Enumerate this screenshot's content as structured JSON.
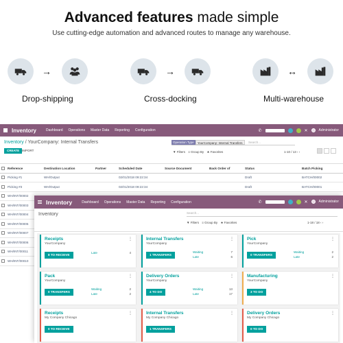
{
  "hero": {
    "title_bold": "Advanced features",
    "title_rest": " made simple",
    "subtitle": "Use cutting-edge automation and advanced routes to manage any warehouse."
  },
  "features": [
    {
      "label": "Drop-shipping",
      "left_icon": "truck-icon",
      "right_icon": "people-icon",
      "arrow": "→"
    },
    {
      "label": "Cross-docking",
      "left_icon": "truck-icon",
      "right_icon": "truck-icon",
      "arrow": "→"
    },
    {
      "label": "Multi-warehouse",
      "left_icon": "factory-icon",
      "right_icon": "factory-icon",
      "arrow": "↔"
    }
  ],
  "colors": {
    "brand": "#875a7b",
    "accent": "#00a09d",
    "icon_circle": "#dde4ea",
    "warning": "#f0ad4e",
    "danger": "#e45c4a"
  },
  "win1": {
    "app_name": "Inventory",
    "menus": [
      "Dashboard",
      "Operations",
      "Master Data",
      "Reporting",
      "Configuration"
    ],
    "user": "Administrator",
    "breadcrumb_root": "Inventory",
    "breadcrumb_sep": " / ",
    "breadcrumb_current": "YourCompany: Internal Transfers",
    "create": "CREATE",
    "import": "IMPORT",
    "facet_key": "Operation Type",
    "facet_value": "YourCompany: Internal Transfers",
    "search_placeholder": "Search...",
    "filters": "Filters",
    "group_by": "Group By",
    "favorites": "Favorites",
    "pager": "1-10 / 13",
    "columns": [
      "Reference",
      "Destination Location",
      "Partner",
      "Scheduled Date",
      "Source Document",
      "Back Order of",
      "Status",
      "Batch Picking"
    ],
    "rows": [
      [
        "Picking #1",
        "WH/Output",
        "",
        "02/01/2018 09:22:34",
        "",
        "",
        "Draft",
        "BATCH/00002"
      ],
      [
        "Picking #3",
        "WH/Output",
        "",
        "02/01/2018 09:22:34",
        "",
        "",
        "Draft",
        "BATCH/00001"
      ],
      [
        "WH/INT/00002",
        "",
        "",
        "",
        "",
        "",
        "",
        ""
      ],
      [
        "WH/INT/00003",
        "",
        "",
        "",
        "",
        "",
        "",
        ""
      ],
      [
        "WH/INT/00004",
        "",
        "",
        "",
        "",
        "",
        "",
        ""
      ],
      [
        "WH/INT/00005",
        "",
        "",
        "",
        "",
        "",
        "",
        ""
      ],
      [
        "WH/INT/00007",
        "",
        "",
        "",
        "",
        "",
        "",
        ""
      ],
      [
        "WH/INT/00006",
        "",
        "",
        "",
        "",
        "",
        "",
        ""
      ],
      [
        "WH/INT/00011",
        "",
        "",
        "",
        "",
        "",
        "",
        ""
      ],
      [
        "WH/INT/00010",
        "",
        "",
        "",
        "",
        "",
        "",
        ""
      ]
    ]
  },
  "win2": {
    "app_name": "Inventory",
    "menus": [
      "Dashboard",
      "Operations",
      "Master Data",
      "Reporting",
      "Configuration"
    ],
    "user": "Administrator",
    "title": "Inventory",
    "search_placeholder": "Search...",
    "filters": "Filters",
    "group_by": "Group By",
    "favorites": "Favorites",
    "pager": "1-18 / 18",
    "cards": [
      {
        "title": "Receipts",
        "company": "YourCompany",
        "button": "8 TO RECEIVE",
        "accent": "#00a09d",
        "stats": [
          {
            "label": "Late",
            "value": "4"
          }
        ]
      },
      {
        "title": "Internal Transfers",
        "company": "YourCompany",
        "button": "1 TRANSFERS",
        "accent": "#00a09d",
        "stats": [
          {
            "label": "Waiting",
            "value": "7"
          },
          {
            "label": "Late",
            "value": "6"
          }
        ]
      },
      {
        "title": "Pick",
        "company": "YourCompany",
        "button": "0 TRANSFERS",
        "accent": "#00a09d",
        "stats": [
          {
            "label": "Waiting",
            "value": "2"
          },
          {
            "label": "Late",
            "value": "2"
          }
        ]
      },
      {
        "title": "Pack",
        "company": "YourCompany",
        "button": "0 TRANSFERS",
        "accent": "#00a09d",
        "stats": [
          {
            "label": "Waiting",
            "value": "2"
          },
          {
            "label": "Late",
            "value": "2"
          }
        ]
      },
      {
        "title": "Delivery Orders",
        "company": "YourCompany",
        "button": "4 TO DO",
        "accent": "#00a09d",
        "stats": [
          {
            "label": "Waiting",
            "value": "13"
          },
          {
            "label": "Late",
            "value": "17"
          }
        ]
      },
      {
        "title": "Manufacturing",
        "company": "YourCompany",
        "button": "3 TO DO",
        "accent": "#f0ad4e",
        "stats": []
      },
      {
        "title": "Receipts",
        "company": "My Company Chicago",
        "button": "0 TO RECEIVE",
        "accent": "#e45c4a",
        "stats": []
      },
      {
        "title": "Internal Transfers",
        "company": "My Company Chicago",
        "button": "1 TRANSFERS",
        "accent": "#e45c4a",
        "stats": []
      },
      {
        "title": "Delivery Orders",
        "company": "My Company Chicago",
        "button": "0 TO DO",
        "accent": "#e45c4a",
        "stats": []
      }
    ]
  }
}
